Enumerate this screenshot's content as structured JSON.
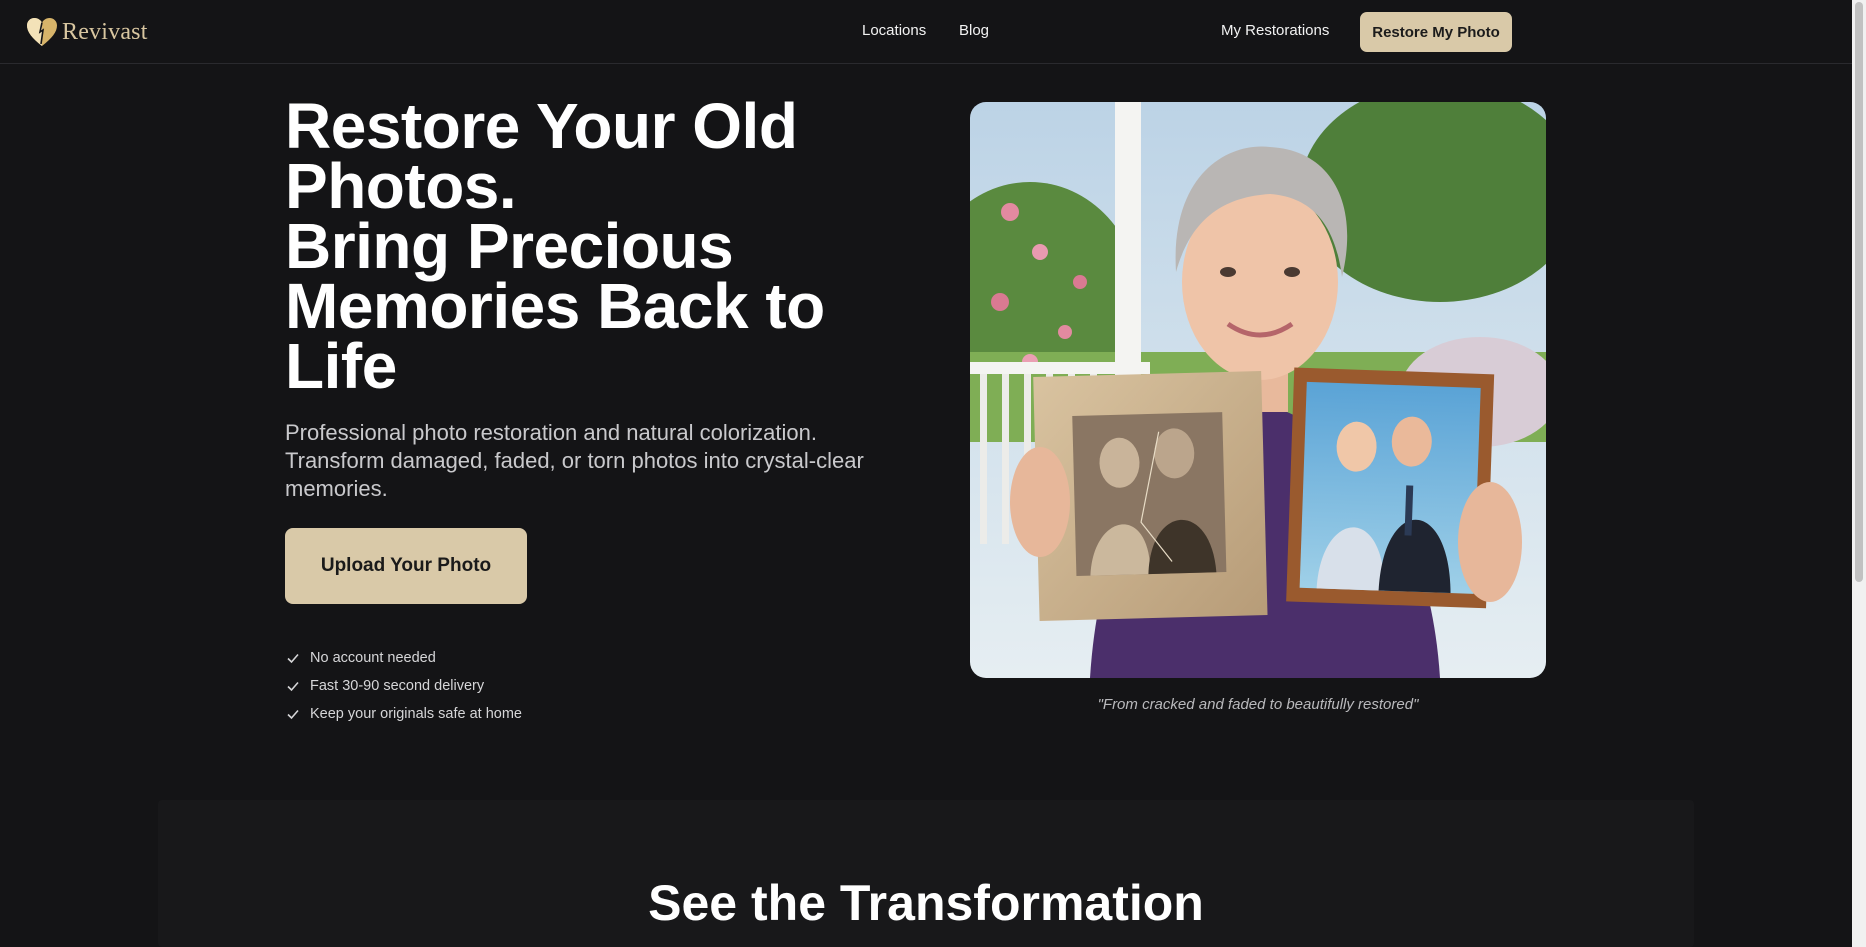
{
  "brand": {
    "name": "Revivast",
    "accent": "#d9c9a8",
    "logo_icon": "heart-logo-icon"
  },
  "nav": {
    "locations": "Locations",
    "blog": "Blog",
    "my_restorations": "My Restorations",
    "cta": "Restore My Photo"
  },
  "hero": {
    "title_line1": "Restore Your Old Photos.",
    "title_line2": "Bring Precious Memories Back to Life",
    "subtitle": "Professional photo restoration and natural colorization. Transform damaged, faded, or torn photos into crystal-clear memories.",
    "upload_button": "Upload Your Photo",
    "features": [
      "No account needed",
      "Fast 30-90 second delivery",
      "Keep your originals safe at home"
    ],
    "photo_caption": "\"From cracked and faded to beautifully restored\""
  },
  "transformation": {
    "title": "See the Transformation"
  }
}
